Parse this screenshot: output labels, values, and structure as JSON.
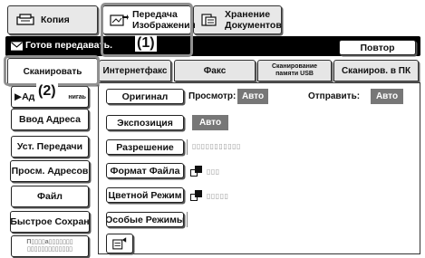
{
  "mode_tabs": {
    "copy": "Копия",
    "transfer_line1": "Передача",
    "transfer_line2": "Изображения",
    "storage_line1": "Хранение",
    "storage_line2": "Документов"
  },
  "callouts": {
    "one": "(1)",
    "two": "(2)"
  },
  "status": {
    "text": "Готов передавать.",
    "repeat_button": "Повтор"
  },
  "function_tabs": [
    "Сканировать",
    "Интернетфакс",
    "Факс",
    "Сканирование памяти USB",
    "Сканиров. в ПК"
  ],
  "sidebar": {
    "first_item_visible": "▶Ад",
    "first_item_tail": "нигаь",
    "items": [
      "Ввод Адреса",
      "Уст. Передачи",
      "Просм. Адресов",
      "Файл",
      "Быстрое Сохран"
    ],
    "last_item_line1": "П▯▯▯▯а▯▯▯▯▯▯▯",
    "last_item_line2": "▯▯▯▯▯▯▯▯▯▯▯▯▯"
  },
  "settings": {
    "original_button": "Оригинал",
    "preview_label": "Просмотр:",
    "preview_value": "Авто",
    "send_label": "Отправить:",
    "send_value": "Авто",
    "exposure_button": "Экспозиция",
    "exposure_value": "Авто",
    "resolution_button": "Разрешение",
    "resolution_value": "▯▯▯▯▯▯▯▯▯▯▯",
    "file_format_button": "Формат Файла",
    "file_format_value": "▯▯▯",
    "color_mode_button": "Цветной Режим",
    "color_mode_value": "▯▯▯▯▯",
    "special_modes_button": "Особые Режимы"
  },
  "icons": {
    "copy": "copier-icon",
    "transfer": "image-send-icon",
    "storage": "document-storage-icon",
    "status": "envelope-icon",
    "bottom": "program-icon"
  }
}
